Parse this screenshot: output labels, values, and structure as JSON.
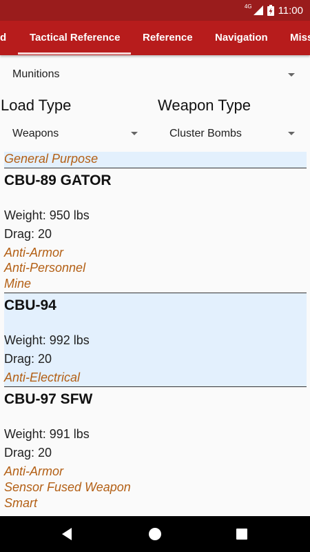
{
  "status_bar": {
    "network": "4G",
    "time": "11:00"
  },
  "tabs": [
    {
      "label": "d"
    },
    {
      "label": "Tactical Reference"
    },
    {
      "label": "Reference"
    },
    {
      "label": "Navigation"
    },
    {
      "label": "Miss"
    }
  ],
  "category_select": {
    "value": "Munitions"
  },
  "filters": {
    "load_type": {
      "label": "Load Type",
      "value": "Weapons"
    },
    "weapon_type": {
      "label": "Weapon Type",
      "value": "Cluster Bombs"
    }
  },
  "list": {
    "previous_tag": "General Purpose",
    "items": [
      {
        "name": "CBU-89 GATOR",
        "weight": "Weight: 950 lbs",
        "drag": "Drag: 20",
        "tags": [
          "Anti-Armor",
          "Anti-Personnel",
          "Mine"
        ]
      },
      {
        "name": "CBU-94",
        "weight": "Weight: 992 lbs",
        "drag": "Drag: 20",
        "tags": [
          "Anti-Electrical"
        ]
      },
      {
        "name": "CBU-97 SFW",
        "weight": "Weight: 991 lbs",
        "drag": "Drag: 20",
        "tags": [
          "Anti-Armor",
          "Sensor Fused Weapon",
          "Smart"
        ]
      }
    ]
  },
  "colors": {
    "status_bar": "#9a1c1c",
    "tab_bar": "#b71c1c",
    "tag_text": "#b35f14",
    "shaded_row": "#e3f0fd"
  }
}
